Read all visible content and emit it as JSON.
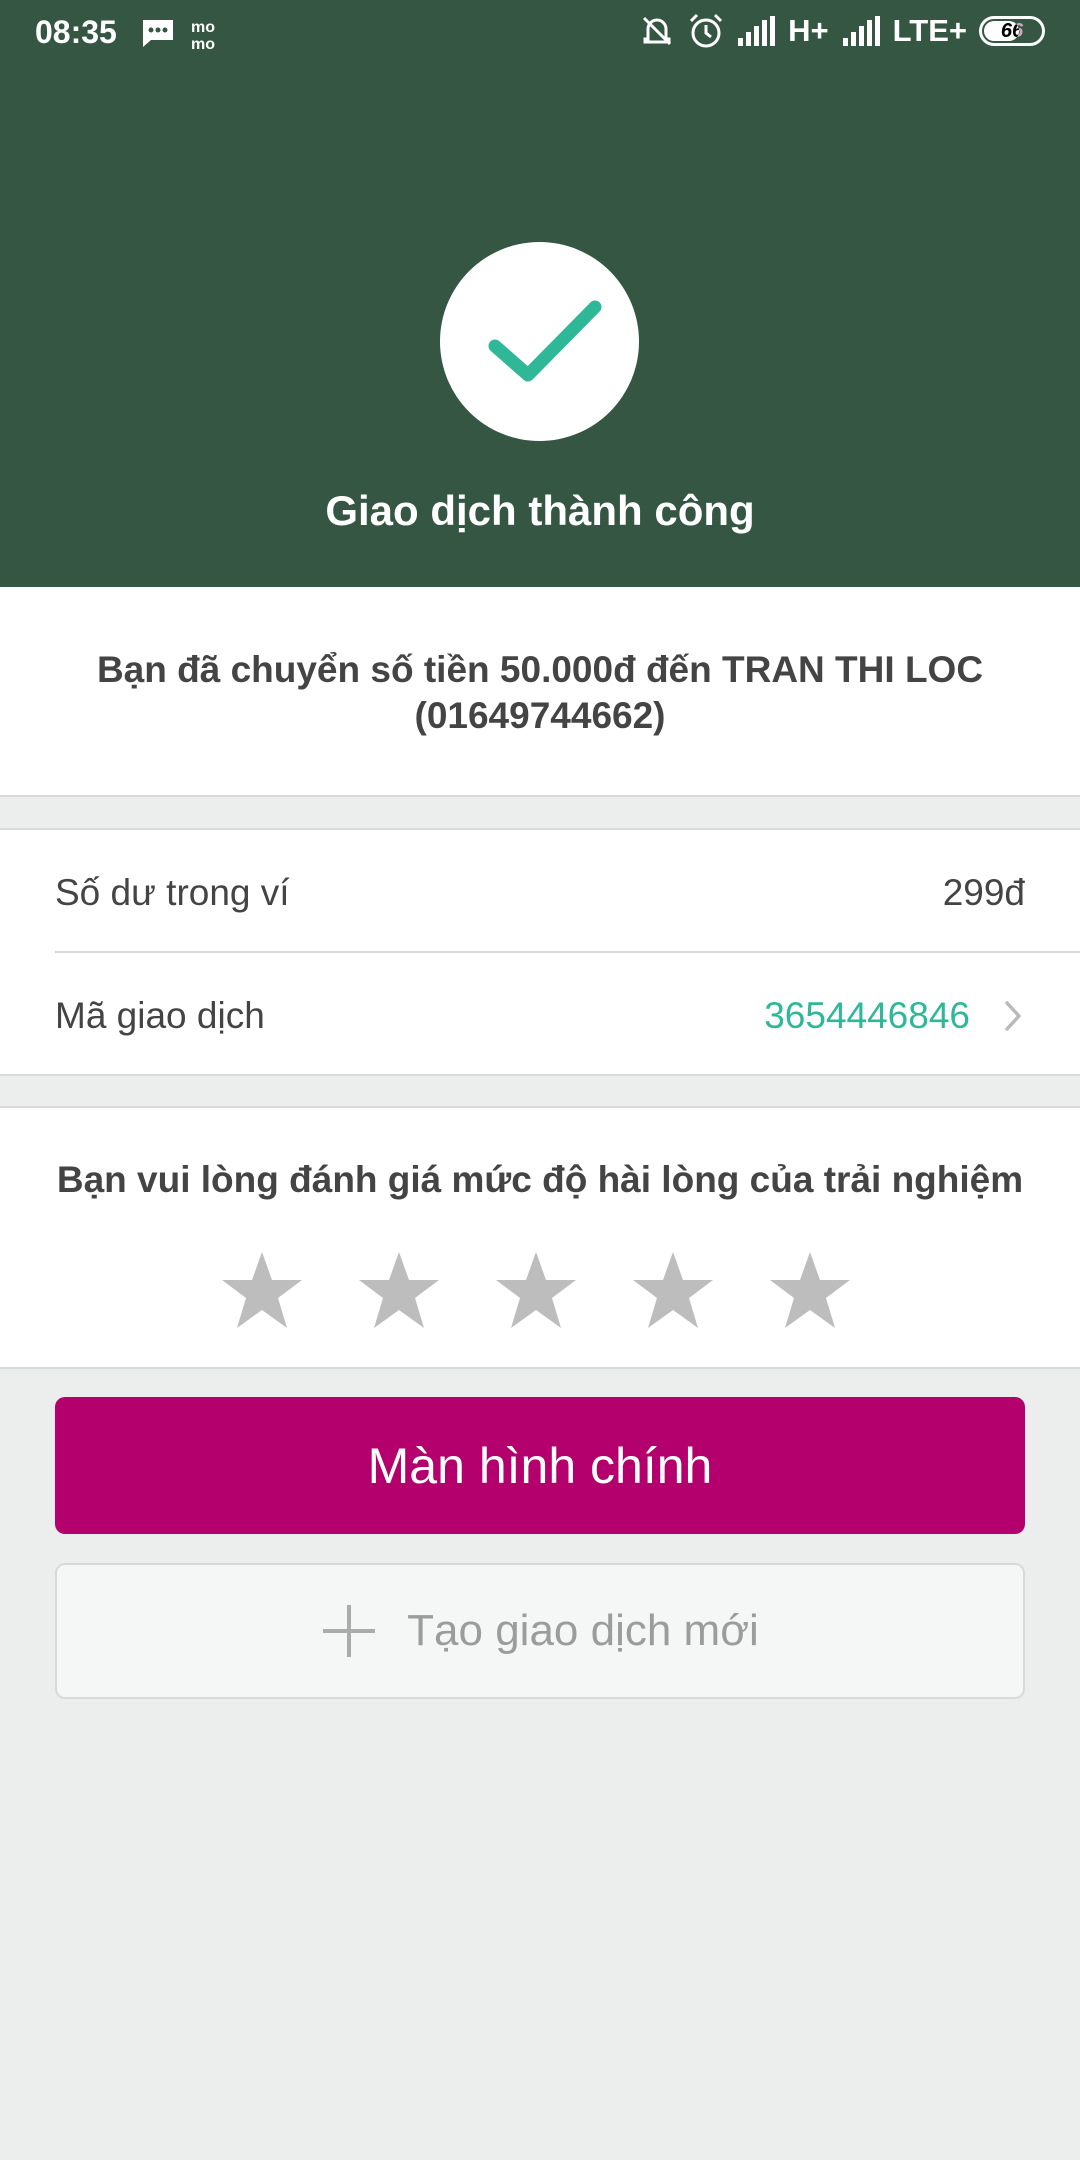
{
  "status_bar": {
    "time": "08:35",
    "network_1": "H+",
    "network_2": "LTE+",
    "battery": "66",
    "icons": [
      "message-icon",
      "momo-icon",
      "mute-icon",
      "alarm-icon",
      "signal-icon",
      "signal-icon"
    ]
  },
  "header": {
    "title": "Giao dịch thành công",
    "background": "#345642",
    "check_color": "#2eb897"
  },
  "message": {
    "text": "Bạn đã chuyển số tiền 50.000đ đến TRAN THI LOC (01649744662)"
  },
  "info": {
    "balance_label": "Số dư trong ví",
    "balance_value": "299đ",
    "transaction_label": "Mã giao dịch",
    "transaction_value": "3654446846"
  },
  "rating": {
    "prompt": "Bạn vui lòng đánh giá mức độ hài lòng của trải nghiệm",
    "star_count": 5,
    "star_color": "#bdbdbd"
  },
  "buttons": {
    "home_label": "Màn hình chính",
    "home_color": "#b3006c",
    "new_transaction_label": "Tạo giao dịch mới"
  }
}
